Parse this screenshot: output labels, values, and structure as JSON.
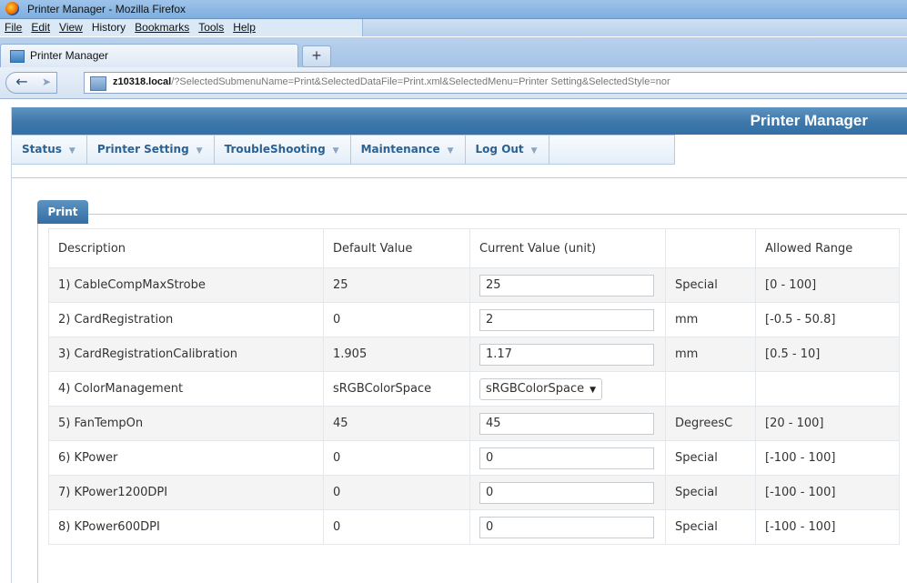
{
  "window": {
    "title": "Printer Manager - Mozilla Firefox"
  },
  "browser_menu": [
    "File",
    "Edit",
    "View",
    "History",
    "Bookmarks",
    "Tools",
    "Help"
  ],
  "tab": {
    "title": "Printer Manager",
    "new_tab": "+"
  },
  "address": {
    "host": "z10318.local",
    "path": "/?SelectedSubmenuName=Print&SelectedDataFile=Print.xml&SelectedMenu=Printer Setting&SelectedStyle=nor"
  },
  "app": {
    "brand": "Printer Manager"
  },
  "menu": [
    "Status",
    "Printer Setting",
    "TroubleShooting",
    "Maintenance",
    "Log Out"
  ],
  "section": {
    "tab_label": "Print"
  },
  "table": {
    "headers": [
      "Description",
      "Default Value",
      "Current Value (unit)",
      "",
      "Allowed Range"
    ],
    "rows": [
      {
        "description": "1) CableCompMaxStrobe",
        "default": "25",
        "current": "25",
        "unit": "Special",
        "range": "[0 - 100]",
        "control": "input"
      },
      {
        "description": "2) CardRegistration",
        "default": "0",
        "current": "2",
        "unit": "mm",
        "range": "[-0.5 - 50.8]",
        "control": "input"
      },
      {
        "description": "3) CardRegistrationCalibration",
        "default": "1.905",
        "current": "1.17",
        "unit": "mm",
        "range": "[0.5 - 10]",
        "control": "input"
      },
      {
        "description": "4) ColorManagement",
        "default": "sRGBColorSpace",
        "current": "sRGBColorSpace",
        "unit": "",
        "range": "",
        "control": "select"
      },
      {
        "description": "5) FanTempOn",
        "default": "45",
        "current": "45",
        "unit": "DegreesC",
        "range": "[20 - 100]",
        "control": "input"
      },
      {
        "description": "6) KPower",
        "default": "0",
        "current": "0",
        "unit": "Special",
        "range": "[-100 - 100]",
        "control": "input"
      },
      {
        "description": "7) KPower1200DPI",
        "default": "0",
        "current": "0",
        "unit": "Special",
        "range": "[-100 - 100]",
        "control": "input"
      },
      {
        "description": "8) KPower600DPI",
        "default": "0",
        "current": "0",
        "unit": "Special",
        "range": "[-100 - 100]",
        "control": "input"
      }
    ]
  }
}
